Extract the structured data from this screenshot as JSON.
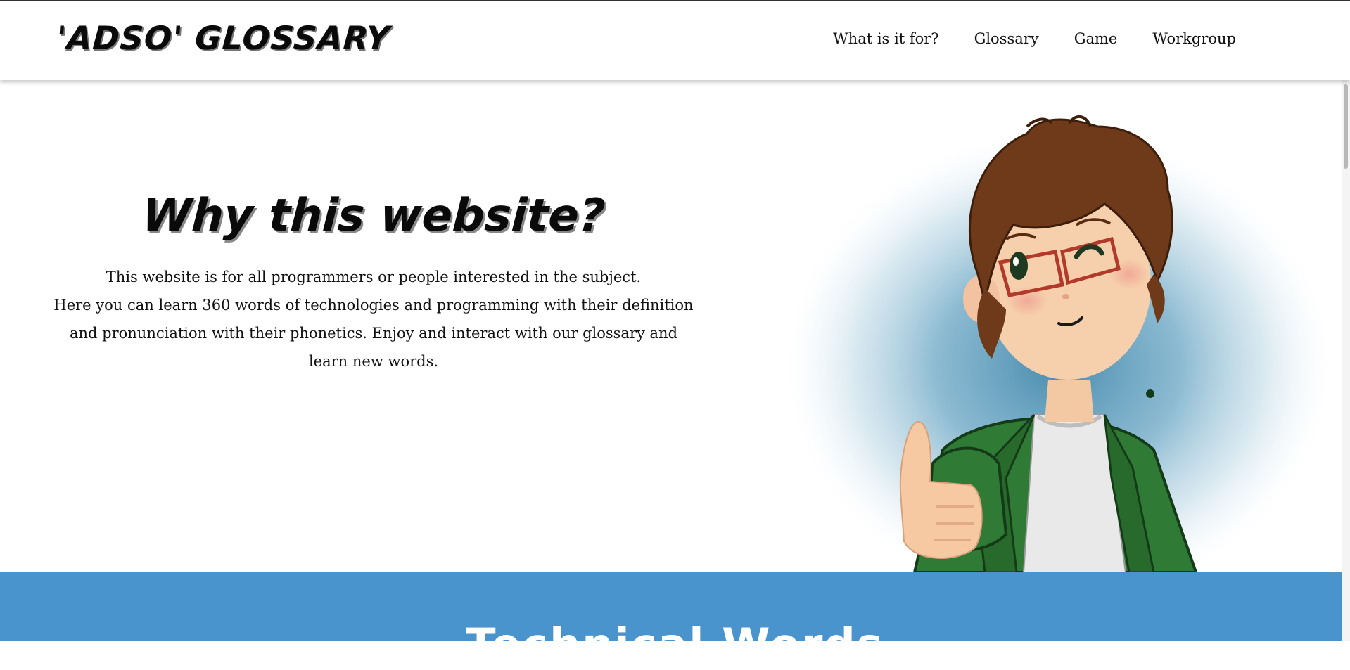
{
  "header": {
    "brand": "'ADSO' GLOSSARY",
    "nav": [
      {
        "label": "What is it for?"
      },
      {
        "label": "Glossary"
      },
      {
        "label": "Game"
      },
      {
        "label": "Workgroup"
      }
    ]
  },
  "hero": {
    "title": "Why this website?",
    "lines": [
      "This website is for all programmers or people interested in the subject.",
      "Here you can learn 360 words of technologies and programming with their definition",
      "and pronunciation with their phonetics. Enjoy and interact with our glossary and",
      "learn new words."
    ],
    "illustration": "cartoon-boy-thumbs-up"
  },
  "next_section": {
    "title": "Technical Words",
    "color": "#4a94cd"
  },
  "colors": {
    "accent": "#4a94cd",
    "jacket": "#2f7a35",
    "hair": "#6e3a1a"
  }
}
